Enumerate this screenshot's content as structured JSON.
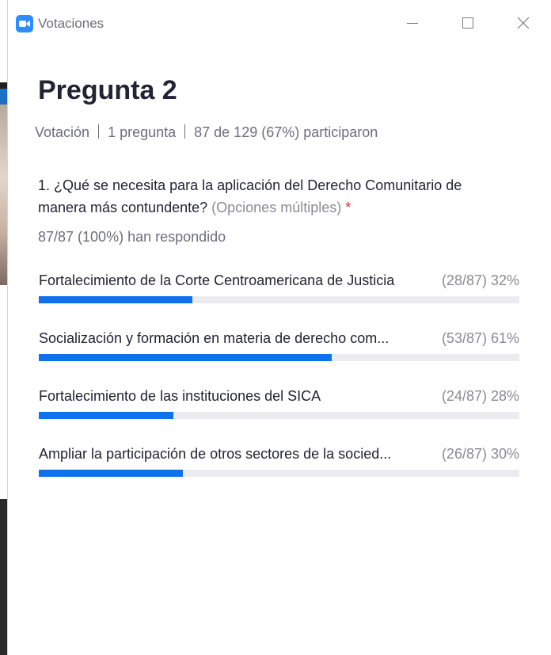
{
  "window": {
    "title": "Votaciones",
    "icon": "zoom-camera-icon",
    "accent": "#2d8cff"
  },
  "poll": {
    "heading": "Pregunta 2",
    "meta": {
      "type": "Votación",
      "count": "1 pregunta",
      "participation": "87 de 129 (67%) participaron"
    },
    "question": {
      "text": "1. ¿Qué se necesita para la aplicación del Derecho Comunitario de manera más contundente?",
      "hint": "(Opciones múltiples)",
      "required_mark": "*"
    },
    "responded": "87/87 (100%) han respondido",
    "bar_color": "#0e72ed",
    "options": [
      {
        "label": "Fortalecimiento de la Corte Centroamericana de Justicia",
        "stat": "(28/87) 32%",
        "fraction": 0.32
      },
      {
        "label": "Socialización y formación en materia de derecho com...",
        "stat": "(53/87) 61%",
        "fraction": 0.61
      },
      {
        "label": "Fortalecimiento de las instituciones del SICA",
        "stat": "(24/87) 28%",
        "fraction": 0.28
      },
      {
        "label": "Ampliar la participación de otros sectores de la socied...",
        "stat": "(26/87) 30%",
        "fraction": 0.3
      }
    ]
  }
}
